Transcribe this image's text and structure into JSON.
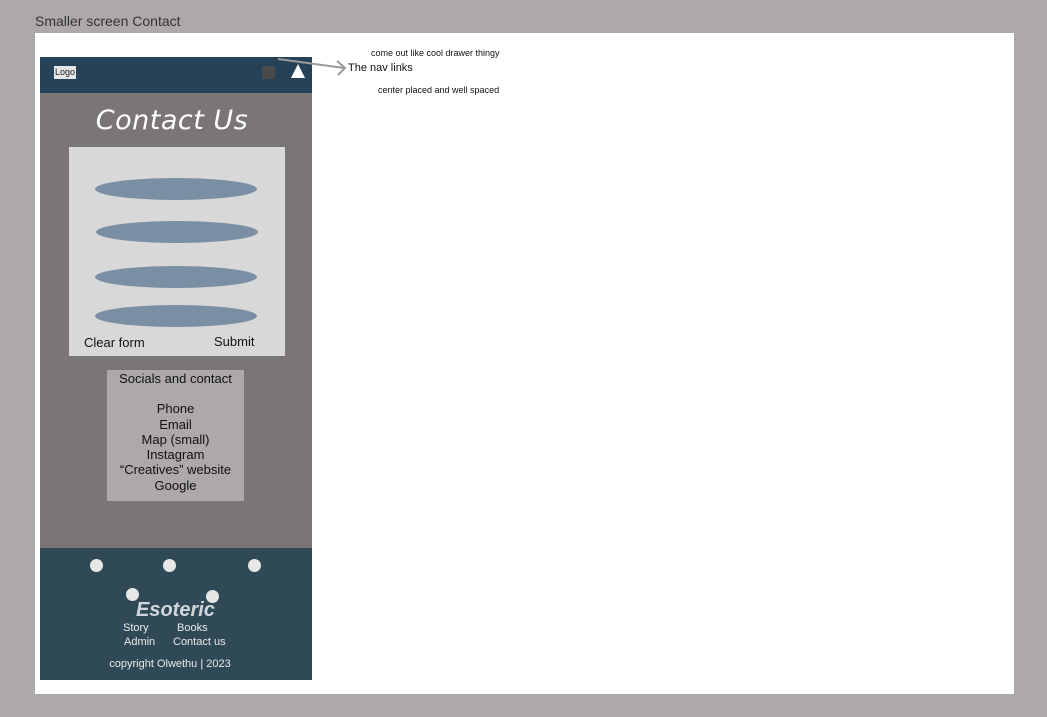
{
  "canvas": {
    "title": "Smaller screen Contact"
  },
  "topbar": {
    "logo": "Logo",
    "square_icon": "square-icon",
    "menu_icon": "triangle-icon"
  },
  "contact": {
    "title": "Contact Us",
    "form": {
      "clear_label": "Clear form",
      "submit_label": "Submit"
    }
  },
  "socials": {
    "heading": "Socials and contact",
    "items": [
      "Phone",
      "Email",
      "Map (small)",
      "Instagram",
      "“Creatives” website",
      "Google"
    ]
  },
  "footer": {
    "brand": "Esoteric",
    "links": [
      "Story",
      "Books",
      "Admin",
      "Contact us"
    ],
    "copyright": "copyright Olwethu | 2023"
  },
  "annotations": {
    "top": "come out like cool drawer thingy",
    "main": "The nav links",
    "bottom": "center placed and well spaced"
  },
  "colors": {
    "topbar": "#254259",
    "body": "#7a7675",
    "field": "#7a8fa4",
    "footer": "#2f4a56"
  }
}
